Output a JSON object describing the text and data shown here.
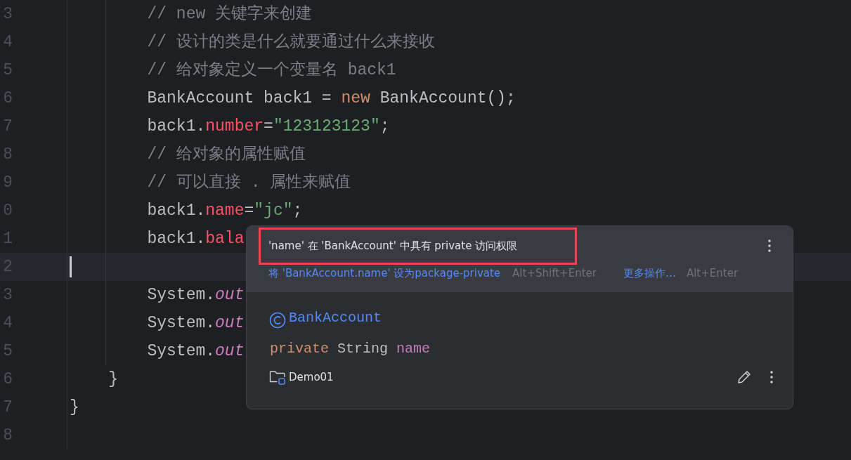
{
  "editor": {
    "lines": [
      {
        "number": "3",
        "current": false,
        "tokens": [
          {
            "kind": "comment",
            "text": "        // new 关键字来创建"
          }
        ]
      },
      {
        "number": "4",
        "current": false,
        "tokens": [
          {
            "kind": "comment",
            "text": "        // 设计的类是什么就要通过什么来接收"
          }
        ]
      },
      {
        "number": "5",
        "current": false,
        "tokens": [
          {
            "kind": "comment",
            "text": "        // 给对象定义一个变量名 back1"
          }
        ]
      },
      {
        "number": "6",
        "current": false,
        "tokens": [
          {
            "kind": "plain",
            "text": "        BankAccount back1 = "
          },
          {
            "kind": "keyword",
            "text": "new"
          },
          {
            "kind": "plain",
            "text": " BankAccount();"
          }
        ]
      },
      {
        "number": "7",
        "current": false,
        "tokens": [
          {
            "kind": "plain",
            "text": "        back1."
          },
          {
            "kind": "field",
            "text": "number"
          },
          {
            "kind": "plain",
            "text": "="
          },
          {
            "kind": "string",
            "text": "\"123123123\""
          },
          {
            "kind": "plain",
            "text": ";"
          }
        ]
      },
      {
        "number": "8",
        "current": false,
        "tokens": [
          {
            "kind": "comment",
            "text": "        // 给对象的属性赋值"
          }
        ]
      },
      {
        "number": "9",
        "current": false,
        "tokens": [
          {
            "kind": "comment",
            "text": "        // 可以直接 . 属性来赋值"
          }
        ]
      },
      {
        "number": "0",
        "current": false,
        "tokens": [
          {
            "kind": "plain",
            "text": "        back1."
          },
          {
            "kind": "field",
            "text": "name"
          },
          {
            "kind": "plain",
            "text": "="
          },
          {
            "kind": "string",
            "text": "\"jc\""
          },
          {
            "kind": "plain",
            "text": ";"
          }
        ]
      },
      {
        "number": "1",
        "current": false,
        "tokens": [
          {
            "kind": "plain",
            "text": "        back1."
          },
          {
            "kind": "field",
            "text": "bala"
          }
        ]
      },
      {
        "number": "2",
        "current": true
      },
      {
        "number": "3",
        "current": false,
        "tokens": [
          {
            "kind": "plain",
            "text": "        System."
          },
          {
            "kind": "static",
            "text": "out"
          }
        ]
      },
      {
        "number": "4",
        "current": false,
        "tokens": [
          {
            "kind": "plain",
            "text": "        System."
          },
          {
            "kind": "static",
            "text": "out"
          }
        ]
      },
      {
        "number": "5",
        "current": false,
        "tokens": [
          {
            "kind": "plain",
            "text": "        System."
          },
          {
            "kind": "static",
            "text": "out"
          }
        ]
      },
      {
        "number": "6",
        "current": false,
        "tokens": [
          {
            "kind": "plain",
            "text": "    }"
          }
        ]
      },
      {
        "number": "7",
        "current": false,
        "tokens": [
          {
            "kind": "plain",
            "text": "}"
          }
        ]
      },
      {
        "number": "8",
        "current": false
      }
    ]
  },
  "popup": {
    "message": "'name' 在 'BankAccount' 中具有 private 访问权限",
    "actions": [
      {
        "label": "将 'BankAccount.name' 设为package-private",
        "shortcut": "Alt+Shift+Enter"
      },
      {
        "label": "更多操作…",
        "shortcut": "Alt+Enter"
      }
    ],
    "class_name": "BankAccount",
    "declaration": [
      {
        "kind": "keyword",
        "text": "private"
      },
      {
        "kind": "plain",
        "text": " String "
      },
      {
        "kind": "member",
        "text": "name"
      }
    ],
    "module": "Demo01"
  }
}
